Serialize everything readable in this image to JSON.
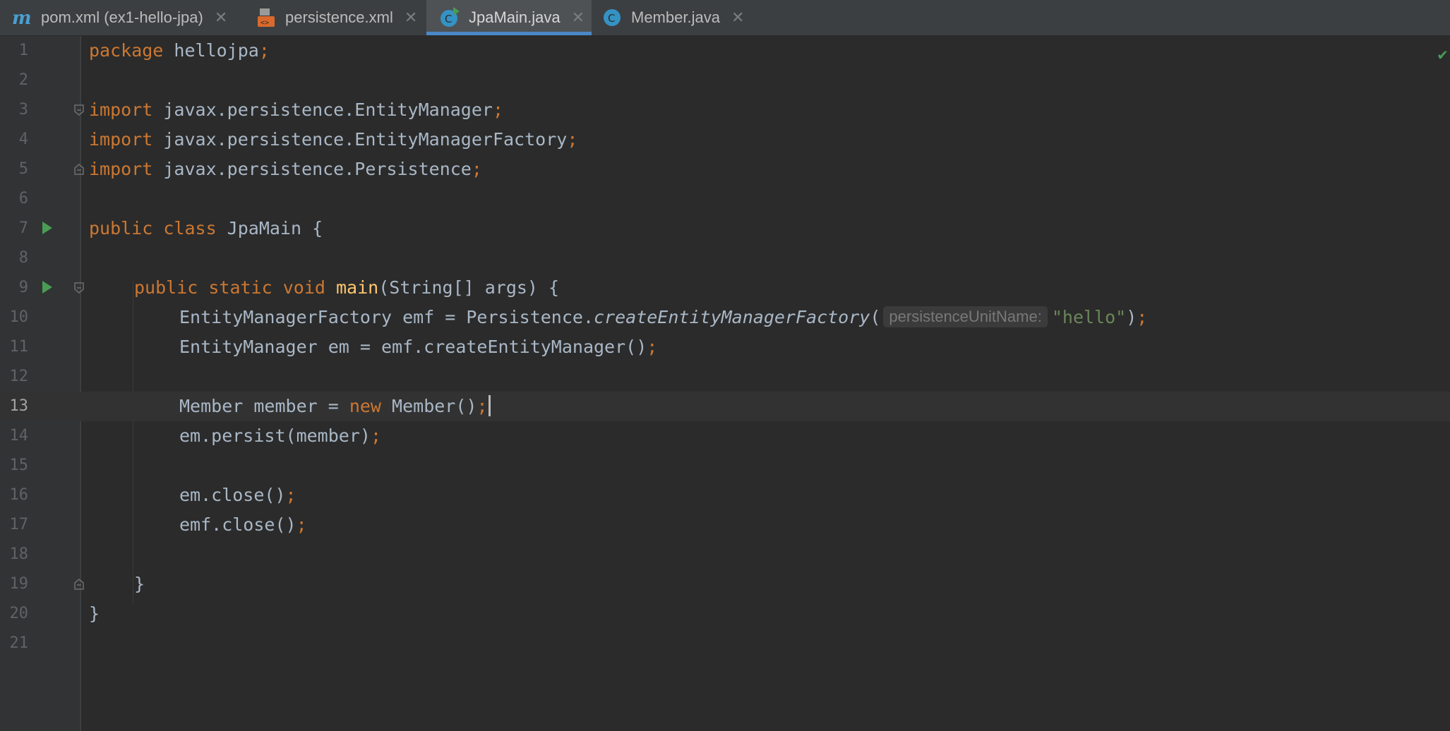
{
  "tabs": [
    {
      "icon": "maven-icon",
      "label": "pom.xml (ex1-hello-jpa)",
      "active": false
    },
    {
      "icon": "xml-file-icon",
      "label": "persistence.xml",
      "active": false
    },
    {
      "icon": "java-class-run-icon",
      "label": "JpaMain.java",
      "active": true
    },
    {
      "icon": "java-class-icon",
      "label": "Member.java",
      "active": false
    }
  ],
  "tab_close_glyph": "✕",
  "editor": {
    "current_line": 13,
    "lines": [
      {
        "n": "1"
      },
      {
        "n": "2"
      },
      {
        "n": "3"
      },
      {
        "n": "4"
      },
      {
        "n": "5"
      },
      {
        "n": "6"
      },
      {
        "n": "7"
      },
      {
        "n": "8"
      },
      {
        "n": "9"
      },
      {
        "n": "10"
      },
      {
        "n": "11"
      },
      {
        "n": "12"
      },
      {
        "n": "13"
      },
      {
        "n": "14"
      },
      {
        "n": "15"
      },
      {
        "n": "16"
      },
      {
        "n": "17"
      },
      {
        "n": "18"
      },
      {
        "n": "19"
      },
      {
        "n": "20"
      },
      {
        "n": "21"
      }
    ],
    "code": {
      "l1_kw": "package",
      "l1_rest": " hellojpa",
      "l3_kw": "import",
      "l3_rest": " javax.persistence.EntityManager",
      "l4_kw": "import",
      "l4_rest": " javax.persistence.EntityManagerFactory",
      "l5_kw": "import",
      "l5_rest": " javax.persistence.Persistence",
      "l7_kw": "public class",
      "l7_rest": " JpaMain {",
      "l9_kw": "public static void",
      "l9_fn": "main",
      "l9_rest": "(String[] args) {",
      "l10_a": "EntityManagerFactory emf = Persistence.",
      "l10_method": "createEntityManagerFactory",
      "l10_paren": "(",
      "l10_hint": "persistenceUnitName:",
      "l10_str": "\"hello\"",
      "l10_close": ")",
      "l11_a": "EntityManager em = emf.createEntityManager()",
      "l13_a": "Member member = ",
      "l13_kw": "new",
      "l13_b": " Member()",
      "l14_a": "em.persist(member)",
      "l16_a": "em.close()",
      "l17_a": "emf.close()",
      "l19_a": "}",
      "l20_a": "}",
      "semicolon": ";"
    }
  },
  "colors": {
    "background": "#2b2b2b",
    "keyword": "#cc7832",
    "function": "#ffc66d",
    "string": "#6a8759",
    "text": "#a9b7c6",
    "run": "#499c54",
    "active_tab_underline": "#4a88c7"
  },
  "inspection_status": "✔"
}
